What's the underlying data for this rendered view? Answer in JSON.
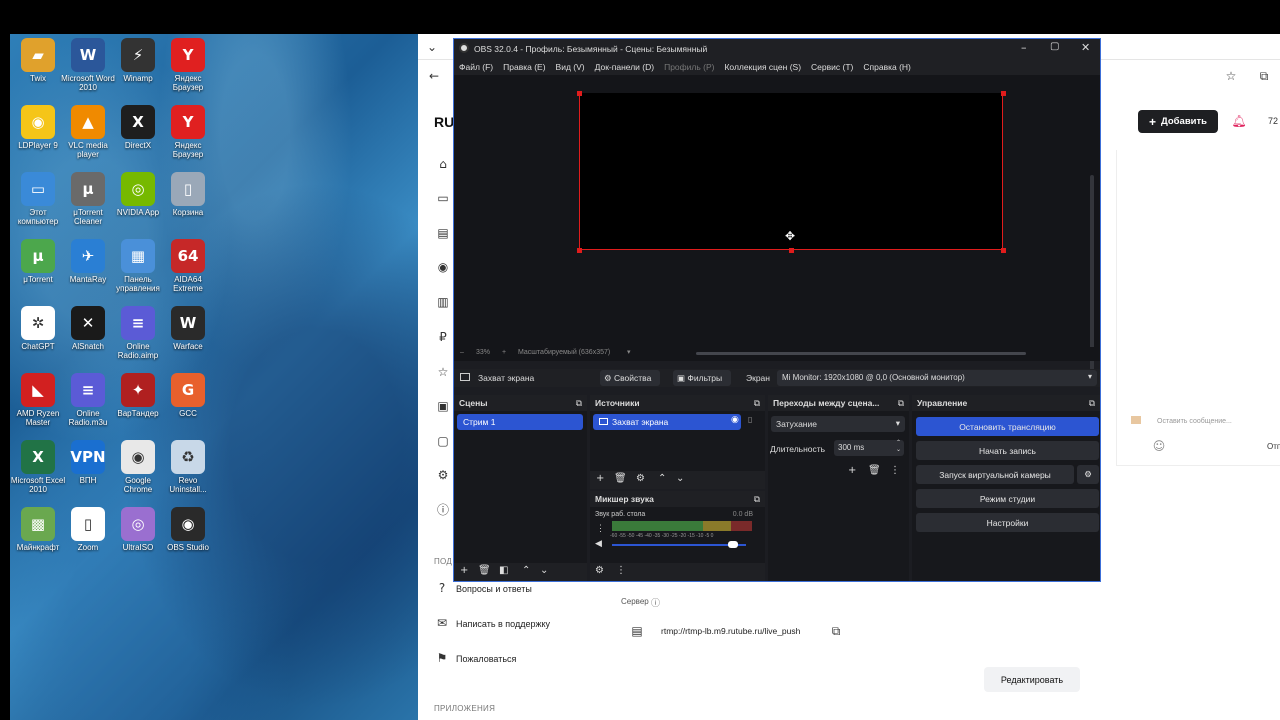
{
  "desktop": {
    "icons": [
      {
        "label": "Twix",
        "icon": "folder-icon",
        "color": "#e0a12c",
        "glyph": "▰"
      },
      {
        "label": "Microsoft Word 2010",
        "icon": "word-icon",
        "color": "#2b579a",
        "glyph": "W"
      },
      {
        "label": "Winamp",
        "icon": "winamp-icon",
        "color": "#333333",
        "glyph": "⚡"
      },
      {
        "label": "Яндекс Браузер",
        "icon": "yandex-browser-icon",
        "color": "#e02020",
        "glyph": "Y"
      },
      {
        "label": "LDPlayer 9",
        "icon": "ldplayer-icon",
        "color": "#f5c518",
        "glyph": "◉"
      },
      {
        "label": "VLC media player",
        "icon": "vlc-icon",
        "color": "#f08a00",
        "glyph": "▲"
      },
      {
        "label": "DirectX",
        "icon": "directx-icon",
        "color": "#1e1e1e",
        "glyph": "X"
      },
      {
        "label": "Яндекс Браузер",
        "icon": "yandex-browser-icon",
        "color": "#e02020",
        "glyph": "Y"
      },
      {
        "label": "Этот компьютер",
        "icon": "computer-icon",
        "color": "#3a8ad8",
        "glyph": "▭"
      },
      {
        "label": "μTorrent Cleaner",
        "icon": "utorrent-cleaner-icon",
        "color": "#6a6a6a",
        "glyph": "μ"
      },
      {
        "label": "NVIDIA App",
        "icon": "nvidia-icon",
        "color": "#76b900",
        "glyph": "◎"
      },
      {
        "label": "Корзина",
        "icon": "recycle-bin-icon",
        "color": "#9aa8b8",
        "glyph": "▯"
      },
      {
        "label": "μTorrent",
        "icon": "utorrent-icon",
        "color": "#4ca74c",
        "glyph": "μ"
      },
      {
        "label": "MantaRay",
        "icon": "mantaray-icon",
        "color": "#2a7fd4",
        "glyph": "✈"
      },
      {
        "label": "Панель управления",
        "icon": "control-panel-icon",
        "color": "#4a90d9",
        "glyph": "▦"
      },
      {
        "label": "AIDA64 Extreme",
        "icon": "aida64-icon",
        "color": "#c62828",
        "glyph": "64"
      },
      {
        "label": "ChatGPT",
        "icon": "chatgpt-icon",
        "color": "#ffffff",
        "glyph": "✲"
      },
      {
        "label": "AlSnatch",
        "icon": "alsnatch-icon",
        "color": "#1a1a1a",
        "glyph": "✕"
      },
      {
        "label": "Online Radio.aimp",
        "icon": "document-icon",
        "color": "#5b5bd6",
        "glyph": "≡"
      },
      {
        "label": "Warface",
        "icon": "warface-icon",
        "color": "#2a2a2a",
        "glyph": "W"
      },
      {
        "label": "AMD Ryzen Master",
        "icon": "amd-icon",
        "color": "#d22020",
        "glyph": "◣"
      },
      {
        "label": "Online Radio.m3u",
        "icon": "document-icon",
        "color": "#5b5bd6",
        "glyph": "≡"
      },
      {
        "label": "ВарТандер",
        "icon": "warthunder-icon",
        "color": "#b02020",
        "glyph": "✦"
      },
      {
        "label": "GCC",
        "icon": "gcc-icon",
        "color": "#e8602c",
        "glyph": "G"
      },
      {
        "label": "Microsoft Excel 2010",
        "icon": "excel-icon",
        "color": "#217346",
        "glyph": "X"
      },
      {
        "label": "ВПН",
        "icon": "vpn-icon",
        "color": "#1a6fd0",
        "glyph": "VPN"
      },
      {
        "label": "Google Chrome",
        "icon": "chrome-icon",
        "color": "#e8e8e8",
        "glyph": "◉"
      },
      {
        "label": "Revo Uninstall...",
        "icon": "revo-icon",
        "color": "#c8d8e8",
        "glyph": "♻"
      },
      {
        "label": "Майнкрафт",
        "icon": "minecraft-icon",
        "color": "#6aa84f",
        "glyph": "▩"
      },
      {
        "label": "Zoom",
        "icon": "document-icon",
        "color": "#ffffff",
        "glyph": "▯"
      },
      {
        "label": "UltraISO",
        "icon": "ultraiso-icon",
        "color": "#9a6fd0",
        "glyph": "◎"
      },
      {
        "label": "OBS Studio",
        "icon": "obs-icon",
        "color": "#2a2a2a",
        "glyph": "◉"
      }
    ]
  },
  "web": {
    "brand_partial": "RU",
    "add_button": "Добавить",
    "counter_partial": "72",
    "sidebar_header_1": "ПОД",
    "sidebar_items": [
      "Вопросы и ответы",
      "Написать в поддержку",
      "Пожаловаться"
    ],
    "sidebar_header_2": "ПРИЛОЖЕНИЯ",
    "server_label": "Сервер",
    "server_url": "rtmp://rtmp-lb.m9.rutube.ru/live_push",
    "edit_button": "Редактировать",
    "chat_placeholder": "Оставить сообщение...",
    "right_partial": "Отп"
  },
  "obs": {
    "title": "OBS 32.0.4 - Профиль: Безымянный - Сцены: Безымянный",
    "menu": [
      "Файл (F)",
      "Правка (E)",
      "Вид (V)",
      "Док-панели (D)",
      "Профиль (P)",
      "Коллекция сцен (S)",
      "Сервис (T)",
      "Справка (H)"
    ],
    "zoom": "33%",
    "scale_mode": "Масштабируемый (636x357)",
    "source_bar": {
      "source_name": "Захват экрана",
      "properties": "Свойства",
      "filters": "Фильтры",
      "screen_label": "Экран",
      "monitor": "Mi Monitor: 1920x1080 @ 0,0 (Основной монитор)"
    },
    "scenes": {
      "title": "Сцены",
      "items": [
        "Стрим 1"
      ]
    },
    "sources": {
      "title": "Источники",
      "items": [
        "Захват экрана"
      ]
    },
    "transitions": {
      "title": "Переходы между сцена...",
      "selected": "Затухание",
      "duration_label": "Длительность",
      "duration": "300 ms"
    },
    "controls": {
      "title": "Управление",
      "buttons": [
        "Остановить трансляцию",
        "Начать запись",
        "Запуск виртуальной камеры",
        "Режим студии",
        "Настройки"
      ]
    },
    "mixer": {
      "title": "Микшер звука",
      "channel": "Звук раб. стола",
      "level": "0.0 dB",
      "scale": "-60 -55 -50 -45 -40 -35 -30 -25 -20 -15 -10 -5 0",
      "volume": 0.9
    }
  }
}
